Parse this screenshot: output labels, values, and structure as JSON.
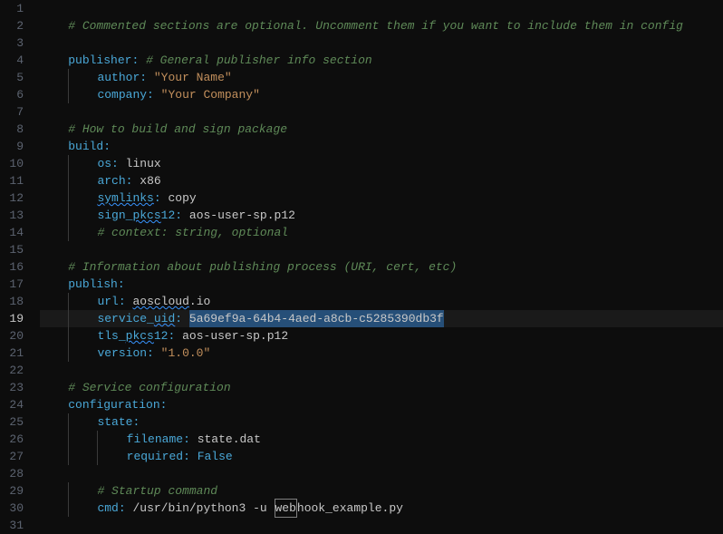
{
  "editor": {
    "active_line": 19,
    "lines": [
      {
        "n": 1,
        "tokens": []
      },
      {
        "n": 2,
        "tokens": [
          {
            "t": "    ",
            "c": ""
          },
          {
            "t": "# Commented sections are optional. Uncomment them if you want to include them in config",
            "c": "comment"
          }
        ]
      },
      {
        "n": 3,
        "tokens": []
      },
      {
        "n": 4,
        "tokens": [
          {
            "t": "    ",
            "c": ""
          },
          {
            "t": "publisher",
            "c": "key"
          },
          {
            "t": ":",
            "c": "colon"
          },
          {
            "t": " ",
            "c": ""
          },
          {
            "t": "# General publisher info section",
            "c": "comment"
          }
        ]
      },
      {
        "n": 5,
        "tokens": [
          {
            "t": "    ",
            "c": ""
          },
          {
            "t": "    ",
            "c": "",
            "bar": true
          },
          {
            "t": "author",
            "c": "key"
          },
          {
            "t": ":",
            "c": "colon"
          },
          {
            "t": " ",
            "c": ""
          },
          {
            "t": "\"Your Name\"",
            "c": "string"
          }
        ]
      },
      {
        "n": 6,
        "tokens": [
          {
            "t": "    ",
            "c": ""
          },
          {
            "t": "    ",
            "c": "",
            "bar": true
          },
          {
            "t": "company",
            "c": "key"
          },
          {
            "t": ":",
            "c": "colon"
          },
          {
            "t": " ",
            "c": ""
          },
          {
            "t": "\"Your Company\"",
            "c": "string"
          }
        ]
      },
      {
        "n": 7,
        "tokens": []
      },
      {
        "n": 8,
        "tokens": [
          {
            "t": "    ",
            "c": ""
          },
          {
            "t": "# How to build and sign package",
            "c": "comment"
          }
        ]
      },
      {
        "n": 9,
        "tokens": [
          {
            "t": "    ",
            "c": ""
          },
          {
            "t": "build",
            "c": "key"
          },
          {
            "t": ":",
            "c": "colon"
          }
        ]
      },
      {
        "n": 10,
        "tokens": [
          {
            "t": "    ",
            "c": ""
          },
          {
            "t": "    ",
            "c": "",
            "bar": true
          },
          {
            "t": "os",
            "c": "key"
          },
          {
            "t": ":",
            "c": "colon"
          },
          {
            "t": " ",
            "c": ""
          },
          {
            "t": "linux",
            "c": "value-plain"
          }
        ]
      },
      {
        "n": 11,
        "tokens": [
          {
            "t": "    ",
            "c": ""
          },
          {
            "t": "    ",
            "c": "",
            "bar": true
          },
          {
            "t": "arch",
            "c": "key"
          },
          {
            "t": ":",
            "c": "colon"
          },
          {
            "t": " ",
            "c": ""
          },
          {
            "t": "x86",
            "c": "value-plain"
          }
        ]
      },
      {
        "n": 12,
        "tokens": [
          {
            "t": "    ",
            "c": ""
          },
          {
            "t": "    ",
            "c": "",
            "bar": true
          },
          {
            "t": "symlinks",
            "c": "key",
            "wave": true
          },
          {
            "t": ":",
            "c": "colon"
          },
          {
            "t": " ",
            "c": ""
          },
          {
            "t": "copy",
            "c": "value-plain"
          }
        ]
      },
      {
        "n": 13,
        "tokens": [
          {
            "t": "    ",
            "c": ""
          },
          {
            "t": "    ",
            "c": "",
            "bar": true
          },
          {
            "t": "sign_pkcs12",
            "c": "key",
            "wave_partial": "pkcs"
          },
          {
            "t": ":",
            "c": "colon"
          },
          {
            "t": " ",
            "c": ""
          },
          {
            "t": "aos-user-sp.p12",
            "c": "value-plain"
          }
        ]
      },
      {
        "n": 14,
        "tokens": [
          {
            "t": "    ",
            "c": ""
          },
          {
            "t": "    ",
            "c": "",
            "bar": true
          },
          {
            "t": "# context: string, optional",
            "c": "comment"
          }
        ]
      },
      {
        "n": 15,
        "tokens": []
      },
      {
        "n": 16,
        "tokens": [
          {
            "t": "    ",
            "c": ""
          },
          {
            "t": "# Information about publishing process (URI, cert, etc)",
            "c": "comment"
          }
        ]
      },
      {
        "n": 17,
        "tokens": [
          {
            "t": "    ",
            "c": ""
          },
          {
            "t": "publish",
            "c": "key"
          },
          {
            "t": ":",
            "c": "colon"
          }
        ]
      },
      {
        "n": 18,
        "tokens": [
          {
            "t": "    ",
            "c": ""
          },
          {
            "t": "    ",
            "c": "",
            "bar": true
          },
          {
            "t": "url",
            "c": "key"
          },
          {
            "t": ":",
            "c": "colon"
          },
          {
            "t": " ",
            "c": ""
          },
          {
            "t": "aoscloud.io",
            "c": "value-plain",
            "wave_partial": "aoscloud"
          }
        ]
      },
      {
        "n": 19,
        "active": true,
        "tokens": [
          {
            "t": "    ",
            "c": ""
          },
          {
            "t": "    ",
            "c": "",
            "bar": true
          },
          {
            "t": "service_uid",
            "c": "key",
            "wave_partial": "uid"
          },
          {
            "t": ":",
            "c": "colon"
          },
          {
            "t": " ",
            "c": ""
          },
          {
            "t": "5a69ef9a-64b4-4aed-a8cb-c5285390db3f",
            "c": "value-plain",
            "sel": true
          }
        ]
      },
      {
        "n": 20,
        "tokens": [
          {
            "t": "    ",
            "c": ""
          },
          {
            "t": "    ",
            "c": "",
            "bar": true
          },
          {
            "t": "tls_pkcs12",
            "c": "key",
            "wave_partial": "pkcs"
          },
          {
            "t": ":",
            "c": "colon"
          },
          {
            "t": " ",
            "c": ""
          },
          {
            "t": "aos-user-sp.p12",
            "c": "value-plain"
          }
        ]
      },
      {
        "n": 21,
        "tokens": [
          {
            "t": "    ",
            "c": ""
          },
          {
            "t": "    ",
            "c": "",
            "bar": true
          },
          {
            "t": "version",
            "c": "key"
          },
          {
            "t": ":",
            "c": "colon"
          },
          {
            "t": " ",
            "c": ""
          },
          {
            "t": "\"1.0.0\"",
            "c": "string"
          }
        ]
      },
      {
        "n": 22,
        "tokens": []
      },
      {
        "n": 23,
        "tokens": [
          {
            "t": "    ",
            "c": ""
          },
          {
            "t": "# Service configuration",
            "c": "comment"
          }
        ]
      },
      {
        "n": 24,
        "tokens": [
          {
            "t": "    ",
            "c": ""
          },
          {
            "t": "configuration",
            "c": "key"
          },
          {
            "t": ":",
            "c": "colon"
          }
        ]
      },
      {
        "n": 25,
        "tokens": [
          {
            "t": "    ",
            "c": ""
          },
          {
            "t": "    ",
            "c": "",
            "bar": true
          },
          {
            "t": "state",
            "c": "key"
          },
          {
            "t": ":",
            "c": "colon"
          }
        ]
      },
      {
        "n": 26,
        "tokens": [
          {
            "t": "    ",
            "c": ""
          },
          {
            "t": "    ",
            "c": "",
            "bar": true
          },
          {
            "t": "    ",
            "c": "",
            "bar": true
          },
          {
            "t": "filename",
            "c": "key"
          },
          {
            "t": ":",
            "c": "colon"
          },
          {
            "t": " ",
            "c": ""
          },
          {
            "t": "state.dat",
            "c": "value-plain"
          }
        ]
      },
      {
        "n": 27,
        "tokens": [
          {
            "t": "    ",
            "c": ""
          },
          {
            "t": "    ",
            "c": "",
            "bar": true
          },
          {
            "t": "    ",
            "c": "",
            "bar": true
          },
          {
            "t": "required",
            "c": "key"
          },
          {
            "t": ":",
            "c": "colon"
          },
          {
            "t": " ",
            "c": ""
          },
          {
            "t": "False",
            "c": "value-bool"
          }
        ]
      },
      {
        "n": 28,
        "tokens": []
      },
      {
        "n": 29,
        "tokens": [
          {
            "t": "    ",
            "c": ""
          },
          {
            "t": "    ",
            "c": "",
            "bar": true
          },
          {
            "t": "# Startup command",
            "c": "comment"
          }
        ]
      },
      {
        "n": 30,
        "tokens": [
          {
            "t": "    ",
            "c": ""
          },
          {
            "t": "    ",
            "c": "",
            "bar": true
          },
          {
            "t": "cmd",
            "c": "key"
          },
          {
            "t": ":",
            "c": "colon"
          },
          {
            "t": " ",
            "c": ""
          },
          {
            "t": "/usr/bin/python3 -u ",
            "c": "value-plain"
          },
          {
            "t": "web",
            "c": "value-plain",
            "cursor": true
          },
          {
            "t": "hook_example.py",
            "c": "value-plain"
          }
        ]
      },
      {
        "n": 31,
        "tokens": []
      }
    ]
  }
}
